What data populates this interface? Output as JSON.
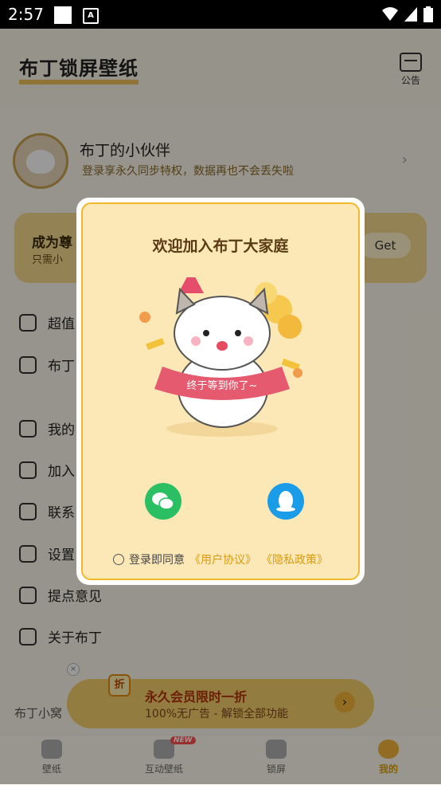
{
  "status_bar": {
    "time": "2:57"
  },
  "header": {
    "title": "布丁锁屏壁纸",
    "announcement": "公告"
  },
  "profile": {
    "name": "布丁的小伙伴",
    "subtitle": "登录享永久同步特权，数据再也不会丢失啦"
  },
  "vip_card": {
    "title": "成为尊",
    "subtitle": "只需小",
    "button": "Get"
  },
  "menu": [
    {
      "label": "超值"
    },
    {
      "label": "布丁"
    },
    {
      "label": "我的"
    },
    {
      "label": "加入"
    },
    {
      "label": "联系"
    },
    {
      "label": "设置"
    },
    {
      "label": "提点意见"
    },
    {
      "label": "关于布丁"
    }
  ],
  "promo": {
    "badge": "折",
    "title": "永久会员限时一折",
    "subtitle": "100%无广告 - 解锁全部功能"
  },
  "nest_label": "布丁小窝",
  "tabs": [
    {
      "label": "壁纸"
    },
    {
      "label": "互动壁纸",
      "badge": "NEW"
    },
    {
      "label": "锁屏"
    },
    {
      "label": "我的"
    }
  ],
  "dialog": {
    "title": "欢迎加入布丁大家庭",
    "banner_text": "终于等到你了~",
    "agree_prefix": "登录即同意",
    "user_agreement": "《用户协议》",
    "privacy_policy": "《隐私政策》"
  },
  "colors": {
    "accent": "#f2b82c",
    "wechat": "#2bbf63",
    "qq": "#1b9ce8",
    "link": "#d99a10"
  }
}
